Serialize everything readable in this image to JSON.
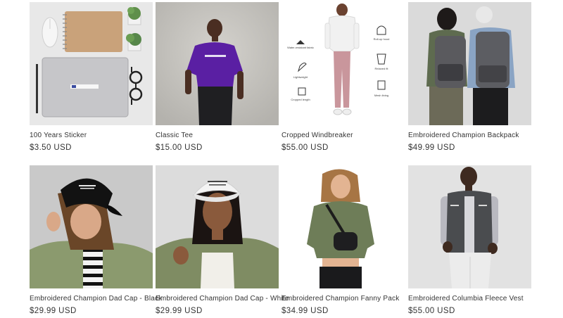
{
  "products": [
    {
      "title": "100 Years Sticker",
      "price": "$3.50 USD"
    },
    {
      "title": "Classic Tee",
      "price": "$15.00 USD"
    },
    {
      "title": "Cropped Windbreaker",
      "price": "$55.00 USD"
    },
    {
      "title": "Embroidered Champion Backpack",
      "price": "$49.99 USD"
    },
    {
      "title": "Embroidered Champion Dad Cap - Black",
      "price": "$29.99 USD"
    },
    {
      "title": "Embroidered Champion Dad Cap - White",
      "price": "$29.99 USD"
    },
    {
      "title": "Embroidered Champion Fanny Pack",
      "price": "$34.99 USD"
    },
    {
      "title": "Embroidered Columbia Fleece Vest",
      "price": "$55.00 USD"
    }
  ],
  "windbreaker_features": {
    "left": [
      "Water-resistant fabric",
      "Lightweight",
      "Cropped length"
    ],
    "right": [
      "Roll-up hood",
      "Relaxed fit",
      "Mesh lining"
    ]
  }
}
